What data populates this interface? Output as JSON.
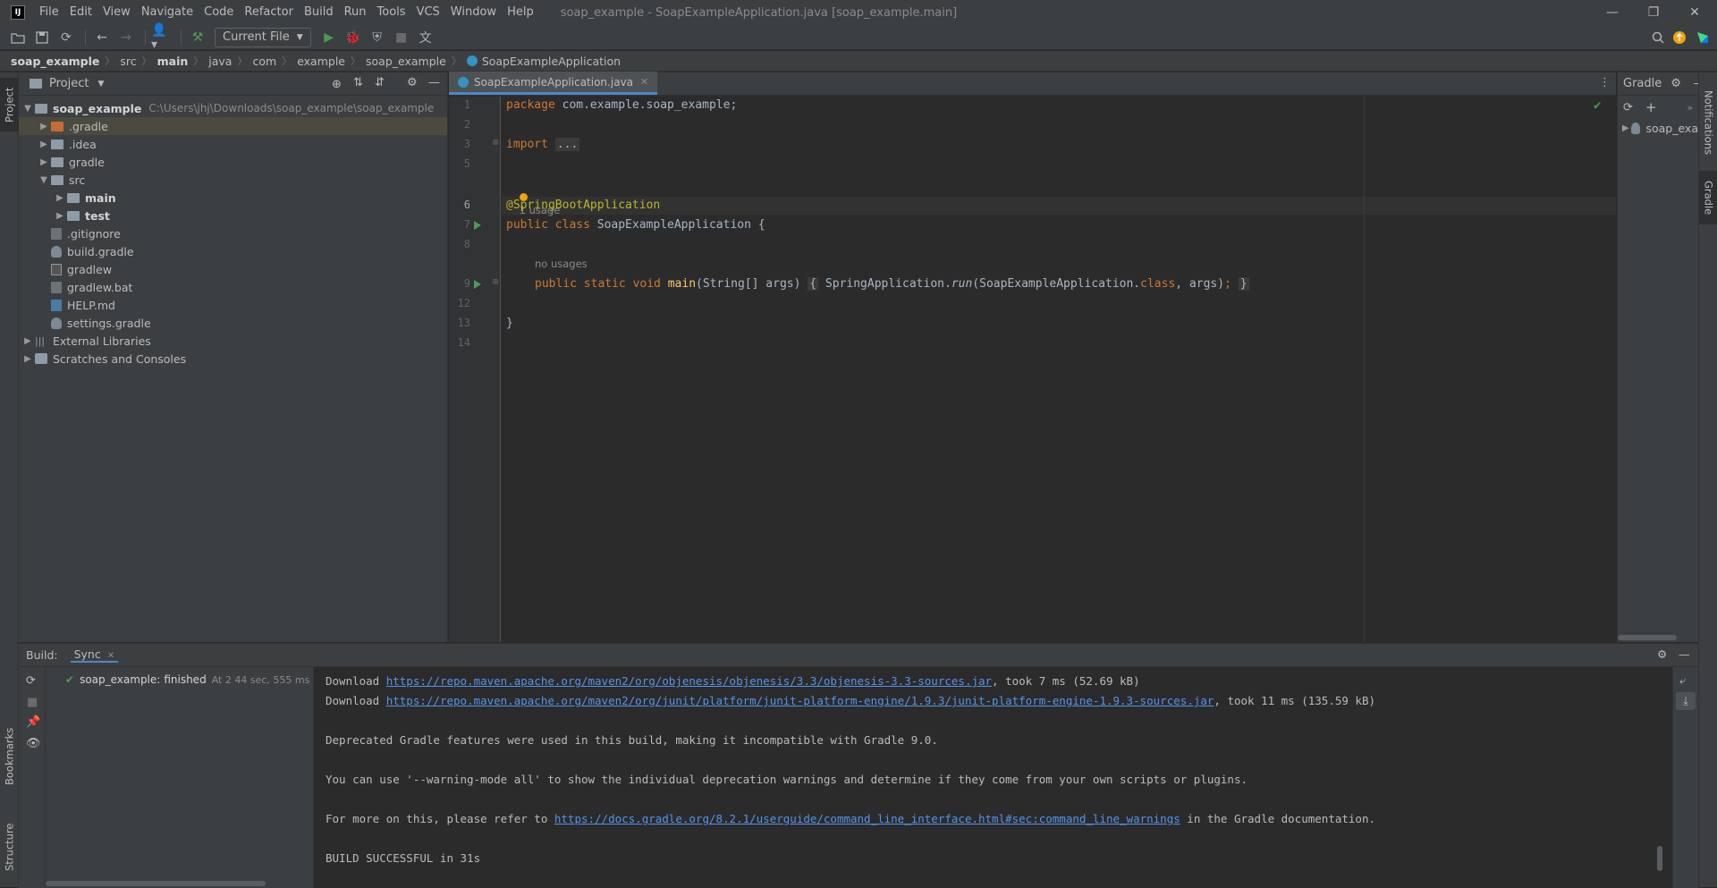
{
  "menu": [
    "File",
    "Edit",
    "View",
    "Navigate",
    "Code",
    "Refactor",
    "Build",
    "Run",
    "Tools",
    "VCS",
    "Window",
    "Help"
  ],
  "window_title": "soap_example - SoapExampleApplication.java [soap_example.main]",
  "toolbar": {
    "run_config": "Current File"
  },
  "breadcrumbs": [
    "soap_example",
    "src",
    "main",
    "java",
    "com",
    "example",
    "soap_example",
    "SoapExampleApplication"
  ],
  "left_stripe": {
    "project": "Project",
    "bookmarks": "Bookmarks",
    "structure": "Structure"
  },
  "right_stripe": {
    "notifications": "Notifications",
    "gradle": "Gradle"
  },
  "project_panel": {
    "title": "Project",
    "root_name": "soap_example",
    "root_path": "C:\\Users\\jhj\\Downloads\\soap_example\\soap_example",
    "items": [
      {
        "label": ".gradle"
      },
      {
        "label": ".idea"
      },
      {
        "label": "gradle"
      },
      {
        "label": "src"
      },
      {
        "label": "main"
      },
      {
        "label": "test"
      },
      {
        "label": ".gitignore"
      },
      {
        "label": "build.gradle"
      },
      {
        "label": "gradlew"
      },
      {
        "label": "gradlew.bat"
      },
      {
        "label": "HELP.md"
      },
      {
        "label": "settings.gradle"
      },
      {
        "label": "External Libraries"
      },
      {
        "label": "Scratches and Consoles"
      }
    ]
  },
  "editor": {
    "tab": "SoapExampleApplication.java",
    "line_numbers": [
      "1",
      "2",
      "3",
      "5",
      "6",
      "7",
      "8",
      "9",
      "12",
      "13",
      "14"
    ],
    "code": {
      "pkg_kw": "package",
      "pkg_name": " com.example.soap_example;",
      "import_kw": "import",
      "import_fold": "...",
      "usage_hint": "1 usage",
      "annotation": "@SpringBootApplication",
      "class_kw": "public class",
      "class_name": " SoapExampleApplication {",
      "no_usages": "no usages",
      "main_kw": "public static void",
      "main_name": "main",
      "main_args": "(String[] args)",
      "body_open": "{",
      "body_call_a": " SpringApplication.",
      "body_call_run": "run",
      "body_call_b": "(SoapExampleApplication.",
      "body_class_kw": "class",
      "body_call_c": ", args)",
      "body_semicolon": ";",
      "body_close": "}",
      "class_close": "}"
    }
  },
  "gradle_panel": {
    "title": "Gradle",
    "tree_item": "soap_exa"
  },
  "build_panel": {
    "label": "Build:",
    "tab": "Sync",
    "status_project": "soap_example:",
    "status_text": "finished",
    "status_time": "At 2 44 sec, 555 ms",
    "console": [
      {
        "prefix": "Download ",
        "link": "https://repo.maven.apache.org/maven2/org/objenesis/objenesis/3.3/objenesis-3.3-sources.jar",
        "suffix": ", took 7 ms (52.69 kB)"
      },
      {
        "prefix": "Download ",
        "link": "https://repo.maven.apache.org/maven2/org/junit/platform/junit-platform-engine/1.9.3/junit-platform-engine-1.9.3-sources.jar",
        "suffix": ", took 11 ms (135.59 kB)"
      },
      {
        "text": "Deprecated Gradle features were used in this build, making it incompatible with Gradle 9.0."
      },
      {
        "text": "You can use '--warning-mode all' to show the individual deprecation warnings and determine if they come from your own scripts or plugins."
      },
      {
        "prefix": "For more on this, please refer to ",
        "link": "https://docs.gradle.org/8.2.1/userguide/command_line_interface.html#sec:command_line_warnings",
        "suffix": " in the Gradle documentation."
      },
      {
        "text": "BUILD SUCCESSFUL in 31s"
      }
    ]
  },
  "colors": {
    "accent": "#4a88c7",
    "success": "#499c54",
    "link": "#5394ec",
    "keyword": "#cc7832",
    "annotation": "#bbb529"
  }
}
